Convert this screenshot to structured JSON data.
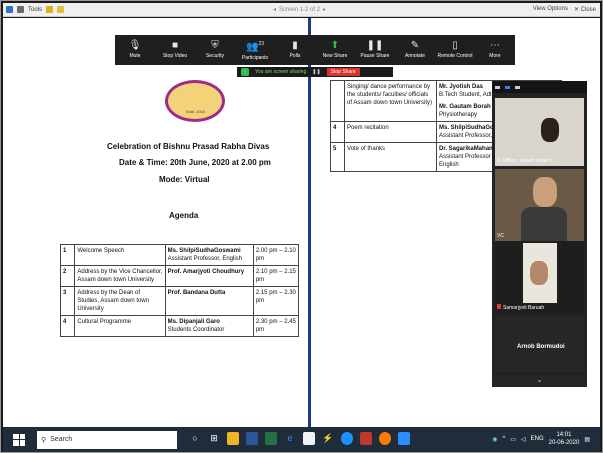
{
  "reader_bar": {
    "tools_label": "Tools",
    "screen_label": "Screen 1-2 of 2",
    "view_options": "View Options",
    "close_label": "Close"
  },
  "zoom_toolbar": {
    "mute": "Mute",
    "stop_video": "Stop Video",
    "security": "Security",
    "participants": "Participants",
    "participant_count": "23",
    "polls": "Polls",
    "new_share": "New Share",
    "pause_share": "Pause Share",
    "annotate": "Annotate",
    "remote_control": "Remote Control",
    "more": "More",
    "sharing_banner": "You are screen sharing",
    "stop_share": "Stop Share"
  },
  "document": {
    "logo_text": "Estd. 2010",
    "title": "Celebration of Bishnu Prasad Rabha Divas",
    "date_line": "Date & Time: 20th June, 2020 at 2.00 pm",
    "mode": "Mode: Virtual",
    "agenda_heading": "Agenda",
    "agenda": [
      {
        "no": "1",
        "activity": "Welcome Speech",
        "person": "Ms. ShilpiSudhaGoswami",
        "role": "Assistant Professor, English",
        "time": "2.00 pm – 2.10 pm"
      },
      {
        "no": "2",
        "activity": "Address by the Vice Chancellor, Assam down town University",
        "person": "Prof. Amarjyoti Choudhury",
        "role": "",
        "time": "2.10 pm – 2.15 pm"
      },
      {
        "no": "3",
        "activity": "Address by the Dean of Studies, Assam down town University",
        "person": "Prof. Bandana Dutta",
        "role": "",
        "time": "2.15 pm – 2.30 pm"
      },
      {
        "no": "4",
        "activity": "Cultural Programme",
        "person": "Ms. Dipanjali Garo",
        "role": "Students Coordinator",
        "time": "2.30 pm – 2.45 pm"
      }
    ],
    "right_rows": [
      {
        "no": "",
        "activity": "Singing/ dance performance by the students/ faculties/ officials of Assam down town University)",
        "person": "Mr. Jyotish Das",
        "role": "B.Tech Student, AdtU",
        "person2": "Mr. Gautam Borah",
        "role2": "Physiotherapy"
      },
      {
        "no": "4",
        "activity": "Poem recitation",
        "person": "Ms. ShilpiSudhaGo",
        "role": "Assistant Professor,",
        "person2": "",
        "role2": ""
      },
      {
        "no": "5",
        "activity": "Vote of thanks",
        "person": "Dr. SagarikaMahan",
        "role": "Assistant Professor &Programme Coord English",
        "person2": "",
        "role2": ""
      }
    ]
  },
  "video_panel": {
    "participants": [
      {
        "name": "IT Officer, Assam down t..."
      },
      {
        "name": "VC"
      },
      {
        "name": "Samarjyoti Baruah"
      },
      {
        "name": "Arnob Bormudoi"
      }
    ]
  },
  "taskbar": {
    "search_placeholder": "Search",
    "language": "ENG",
    "time": "14:01",
    "date": "20-06-2020"
  }
}
